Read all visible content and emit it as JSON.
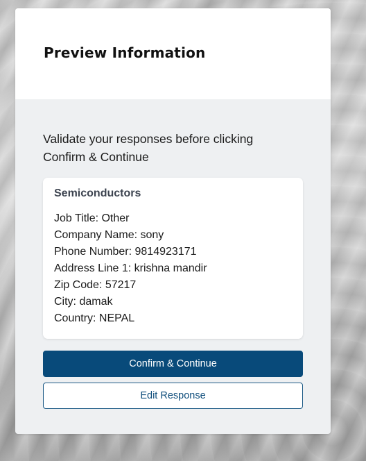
{
  "modal": {
    "title": "Preview Information",
    "instructions": "Validate your responses before clicking Confirm & Continue"
  },
  "summary": {
    "title": "Semiconductors",
    "fields": [
      "Job Title: Other",
      "Company Name: sony",
      "Phone Number: 9814923171",
      "Address Line 1: krishna mandir",
      "Zip Code: 57217",
      "City: damak",
      "Country: NEPAL"
    ]
  },
  "actions": {
    "confirm_label": "Confirm & Continue",
    "edit_label": "Edit Response"
  },
  "colors": {
    "primary": "#084a7a",
    "header_bg": "#ffffff",
    "body_bg": "#eef0f2"
  }
}
